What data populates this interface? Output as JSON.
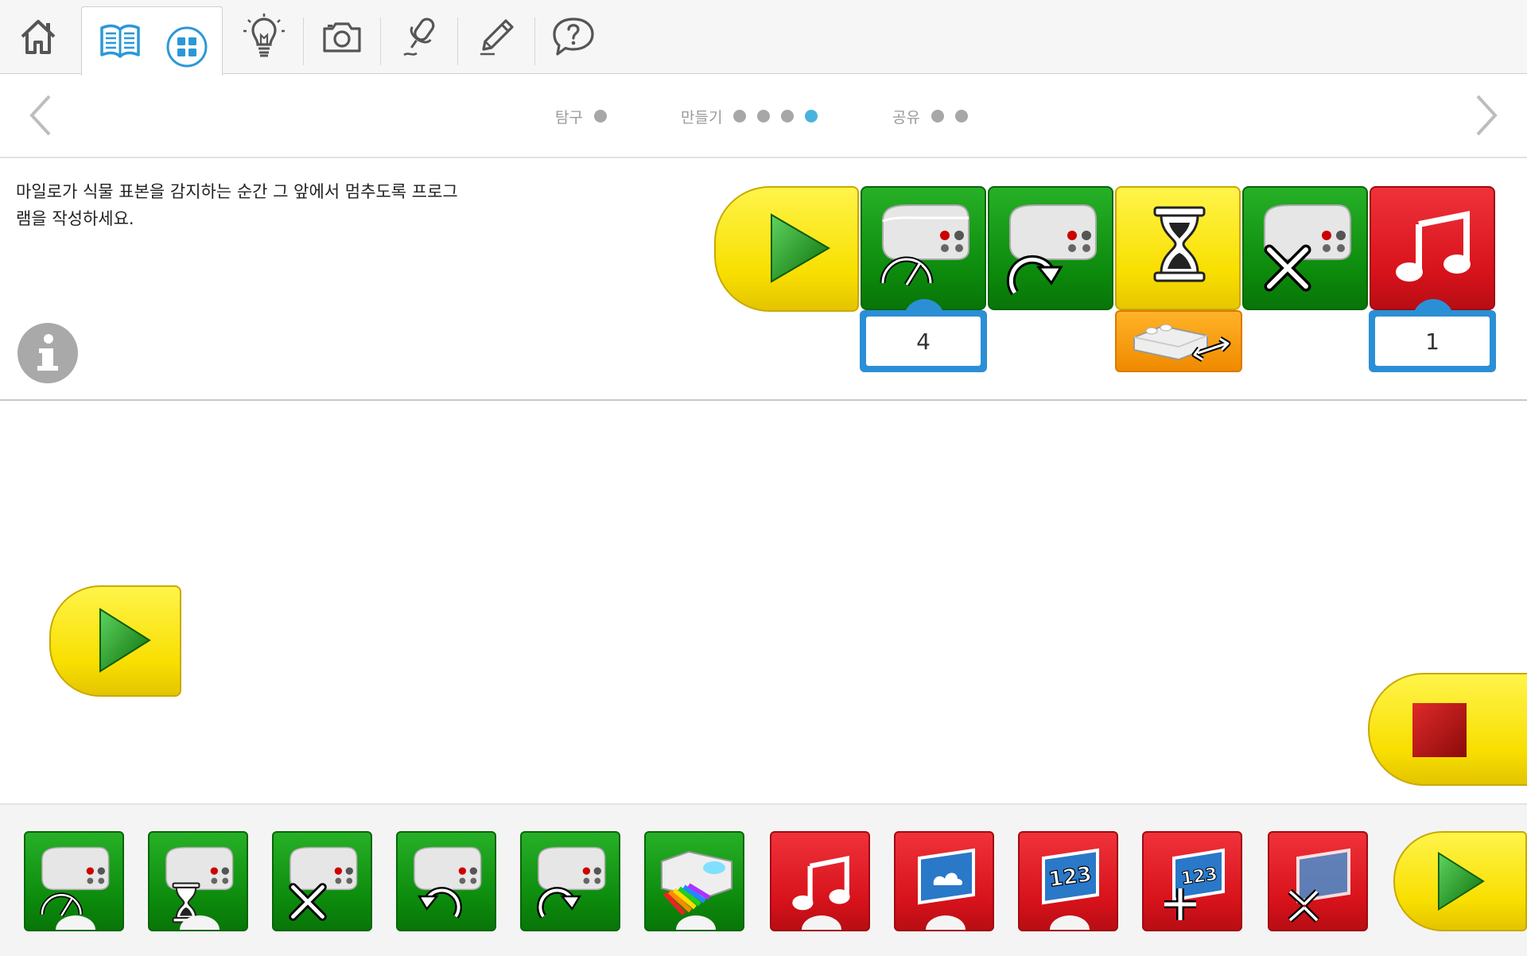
{
  "toolbar": {
    "buttons": [
      "home-icon",
      "book-icon",
      "grid-icon",
      "lightbulb-icon",
      "camera-icon",
      "microphone-icon",
      "pencil-icon",
      "help-icon"
    ]
  },
  "stepnav": {
    "steps": [
      {
        "label": "탐구",
        "dots": 1,
        "active_dot": -1
      },
      {
        "label": "만들기",
        "dots": 4,
        "active_dot": 3
      },
      {
        "label": "공유",
        "dots": 2,
        "active_dot": -1
      }
    ]
  },
  "instruction": {
    "line1": "마일로가 식물 표본을 감지하는 순간 그 앞에서 멈추도록 프로그",
    "line2": "램을 작성하세요."
  },
  "program": {
    "blocks": [
      "start",
      "motor-power",
      "motor-direction",
      "wait-for",
      "motor-off",
      "play-sound"
    ],
    "motor_power_value": "4",
    "sound_value": "1",
    "wait_input": "motion-sensor"
  },
  "palette": {
    "blocks": [
      "motor-power",
      "motor-on-for",
      "motor-off",
      "motor-counterclockwise",
      "motor-clockwise",
      "light-color",
      "play-sound",
      "display-background",
      "display-number",
      "add-to-display",
      "display-size",
      "start-on-key"
    ]
  },
  "colors": {
    "accent": "#4ab3dd",
    "green": "#0c8a0c",
    "yellow": "#f8df00",
    "red": "#d7121b",
    "param_blue": "#2b8fd6",
    "orange": "#f08a00"
  }
}
